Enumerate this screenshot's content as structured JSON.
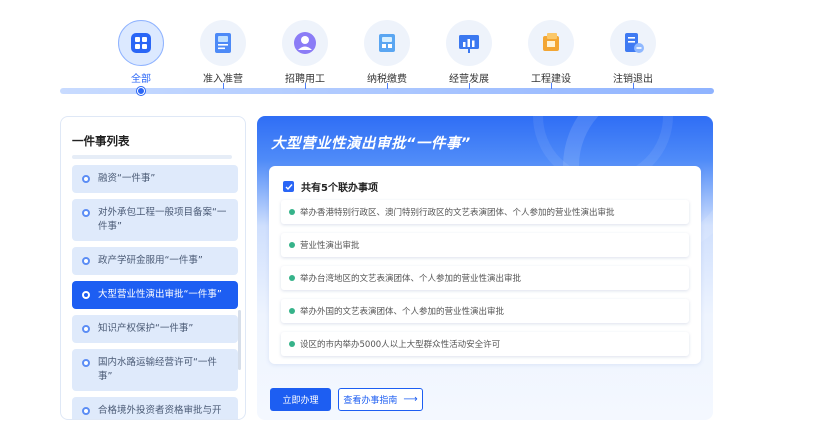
{
  "categories": [
    {
      "label": "全部",
      "icon": "grid-icon",
      "active": true
    },
    {
      "label": "准入准营",
      "icon": "license-card-icon",
      "active": false
    },
    {
      "label": "招聘用工",
      "icon": "user-recruit-icon",
      "active": false
    },
    {
      "label": "纳税缴费",
      "icon": "tax-payment-icon",
      "active": false
    },
    {
      "label": "经营发展",
      "icon": "chart-board-icon",
      "active": false
    },
    {
      "label": "工程建设",
      "icon": "construction-icon",
      "active": false
    },
    {
      "label": "注销退出",
      "icon": "deregister-icon",
      "active": false
    }
  ],
  "list": {
    "title": "一件事列表",
    "items": [
      {
        "label": "融资“一件事”",
        "active": false
      },
      {
        "label": "对外承包工程一般项目备案“一件事”",
        "active": false
      },
      {
        "label": "政产学研金服用“一件事”",
        "active": false
      },
      {
        "label": "大型营业性演出审批“一件事”",
        "active": true
      },
      {
        "label": "知识产权保护“一件事”",
        "active": false
      },
      {
        "label": "国内水路运输经营许可“一件事”",
        "active": false
      },
      {
        "label": "合格境外投资者资格审批与开",
        "active": false
      }
    ]
  },
  "detail": {
    "title": "大型营业性演出审批“一件事”",
    "header": "共有5个联办事项",
    "matters": [
      "举办香港特别行政区、澳门特别行政区的文艺表演团体、个人参加的营业性演出审批",
      "营业性演出审批",
      "举办台湾地区的文艺表演团体、个人参加的营业性演出审批",
      "举办外国的文艺表演团体、个人参加的营业性演出审批",
      "设区的市内举办5000人以上大型群众性活动安全许可"
    ],
    "primary_button": "立即办理",
    "guide_button": "查看办事指南",
    "guide_arrow": "⟶"
  },
  "colors": {
    "accent": "#1d5ef2",
    "list_item_bg": "#dfeafb",
    "status_dot": "#36b38a"
  }
}
